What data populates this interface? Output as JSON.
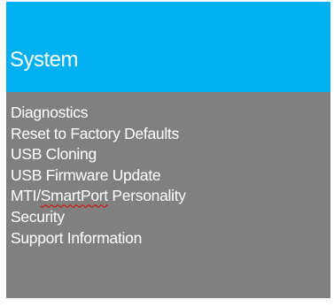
{
  "header": {
    "title": "System"
  },
  "menu": {
    "items": [
      {
        "label": "Diagnostics"
      },
      {
        "label": "Reset to Factory Defaults"
      },
      {
        "label": "USB Cloning"
      },
      {
        "label": "USB Firmware Update"
      },
      {
        "label_prefix": "MTI/",
        "label_marked": "SmartPort",
        "label_suffix": " Personality"
      },
      {
        "label": "Security"
      },
      {
        "label": "Support Information"
      }
    ]
  },
  "colors": {
    "header_bg": "#00b0f0",
    "menu_bg": "#808080",
    "text": "#ffffff",
    "spellcheck_underline": "#e00000"
  }
}
